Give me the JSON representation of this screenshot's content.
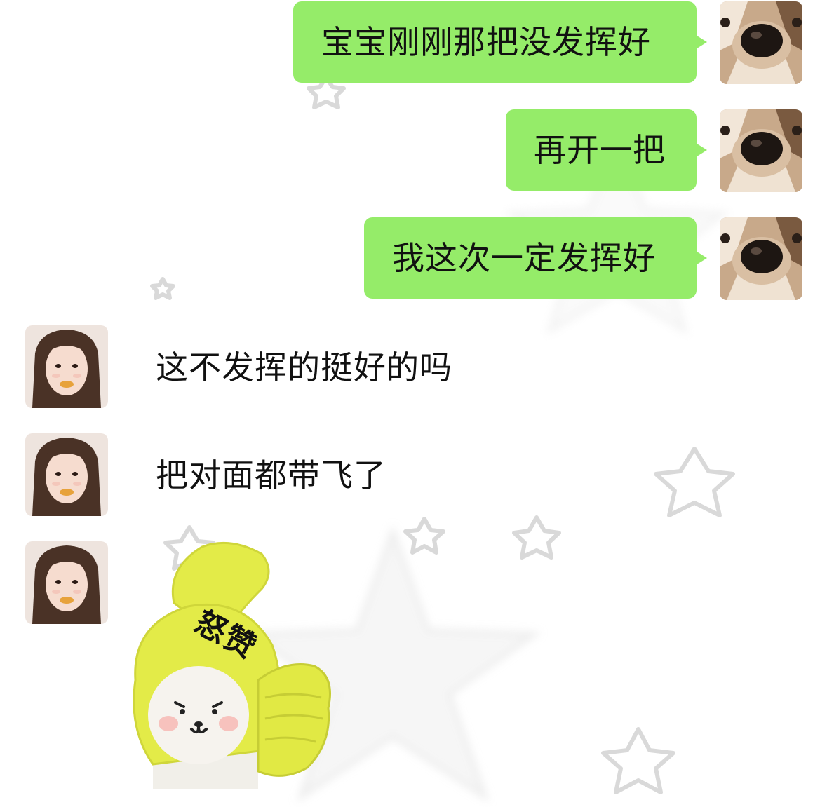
{
  "messages": {
    "sent": [
      {
        "text": "宝宝刚刚那把没发挥好",
        "avatar": "dog-nose-avatar"
      },
      {
        "text": "再开一把",
        "avatar": "dog-nose-avatar"
      },
      {
        "text": "我这次一定发挥好",
        "avatar": "dog-nose-avatar"
      }
    ],
    "received": [
      {
        "text": "这不发挥的挺好的吗",
        "avatar": "girl-avatar"
      },
      {
        "text": "把对面都带飞了",
        "avatar": "girl-avatar"
      },
      {
        "sticker": {
          "caption": "怒赞",
          "icon": "thumbs-up-bear-sticker"
        },
        "avatar": "girl-avatar"
      }
    ]
  },
  "colors": {
    "sent_bubble": "#95ec69",
    "background": "#ffffff",
    "sticker_yellow": "#e3eb48"
  }
}
